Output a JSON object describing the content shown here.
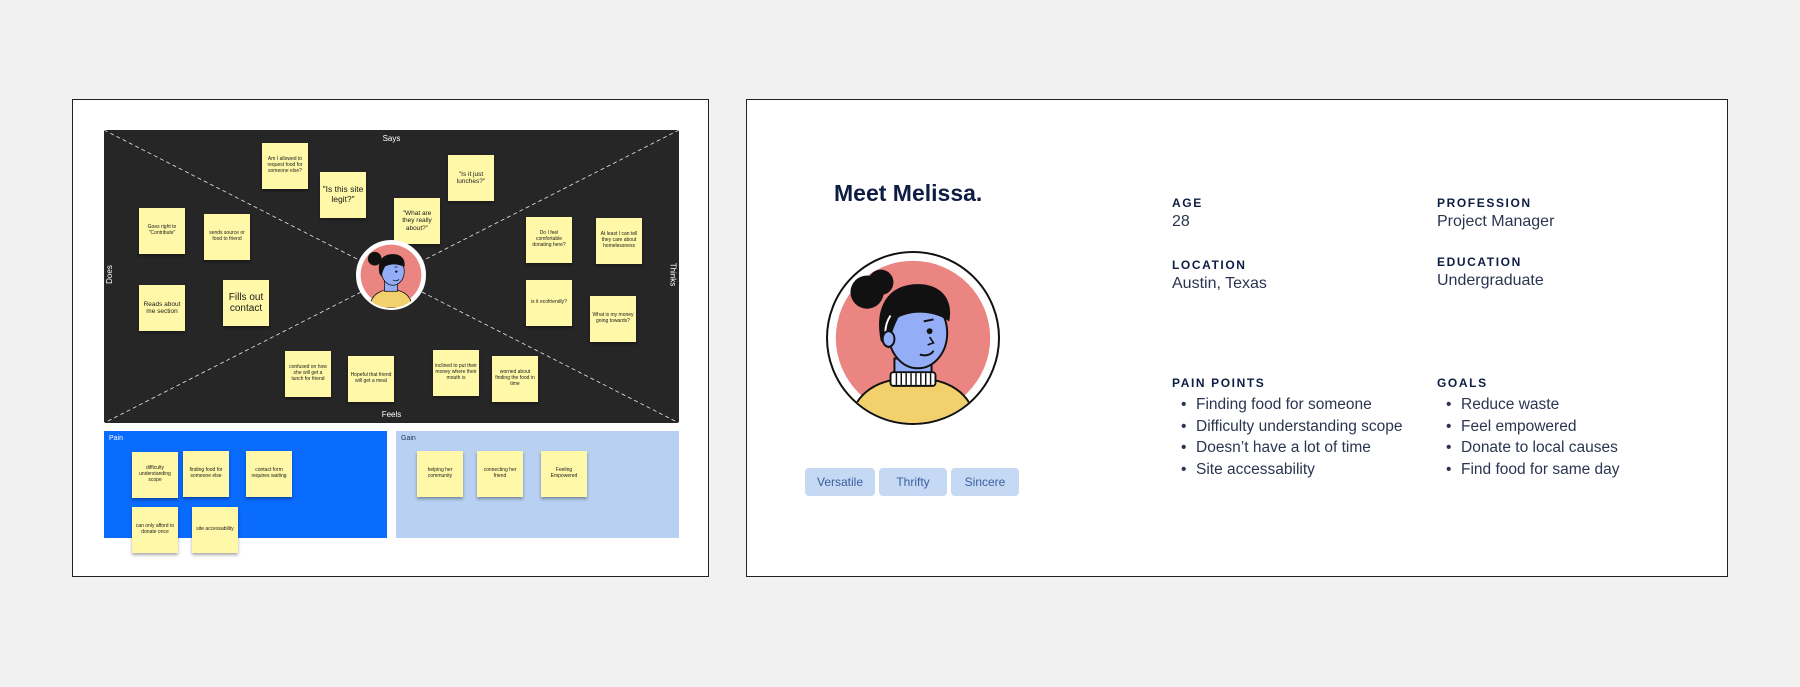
{
  "empathy_map": {
    "quadrants": {
      "says": "Says",
      "thinks": "Thinks",
      "does": "Does",
      "feels": "Feels"
    },
    "stickies": {
      "s1": "Am I allowed to request food for someone else?",
      "s2": "\"Is this site legit?\"",
      "s3": "\"What are they really about?\"",
      "s4": "\"Is it just lunches?\"",
      "s5": "Goes right to \"Contribute\"",
      "s6": "sends source or food to friend",
      "s7": "Reads about me section",
      "s8": "Fills out contact",
      "s9": "Do I feel comfortable donating here?",
      "s10": "At least I can tell they care about homelessness",
      "s11": "is it ecofriendly?",
      "s12": "What is my money going towards?",
      "s13": "confused on how she will get a lunch for friend",
      "s14": "Hopeful that friend will get a meal",
      "s15": "inclined to put their money where their mouth is",
      "s16": "worried about finding the food in time"
    },
    "pain": {
      "label": "Pain",
      "items": {
        "p1": "difficulty understanding scope",
        "p2": "finding food for someone else",
        "p3": "contact form requires waiting",
        "p4": "can only afford to donate once",
        "p5": "site accessability"
      }
    },
    "gain": {
      "label": "Gain",
      "items": {
        "g1": "helping her community",
        "g2": "connecting her friend",
        "g3": "Feeling Empowered"
      }
    }
  },
  "persona": {
    "title": "Meet Melissa.",
    "tags": [
      "Versatile",
      "Thrifty",
      "Sincere"
    ],
    "age": {
      "label": "AGE",
      "value": "28"
    },
    "profession": {
      "label": "PROFESSION",
      "value": "Project Manager"
    },
    "location": {
      "label": "LOCATION",
      "value": "Austin, Texas"
    },
    "education": {
      "label": "EDUCATION",
      "value": "Undergraduate"
    },
    "pain_points": {
      "label": "PAIN POINTS",
      "items": [
        "Finding food for someone",
        "Difficulty understanding scope",
        "Doesn’t have a lot of time",
        "Site accessability"
      ]
    },
    "goals": {
      "label": "GOALS",
      "items": [
        "Reduce waste",
        "Feel empowered",
        "Donate to local causes",
        "Find food for same day"
      ]
    }
  },
  "colors": {
    "canvas": "#f1f1f1",
    "map_background": "#262626",
    "sticky": "#fff8a8",
    "pain_panel": "#0a6bff",
    "gain_panel": "#b8d1f2",
    "avatar_circle": "#ea8582",
    "avatar_skin": "#93aef6",
    "avatar_shirt": "#f2d06b",
    "title_navy": "#0e1d44",
    "tag_bg": "#c5d9f5"
  },
  "icons": {
    "persona_avatar": "woman-avatar-icon"
  }
}
